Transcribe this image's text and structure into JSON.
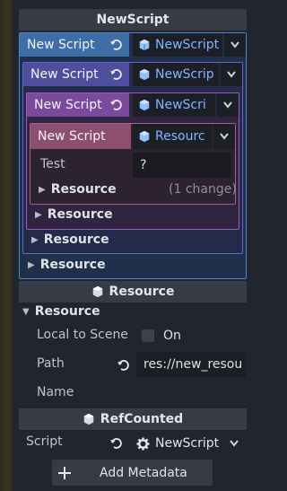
{
  "inspector": {
    "title": "NewScript",
    "nested": [
      {
        "label": "New Script",
        "picker_value": "NewScript"
      },
      {
        "label": "New Script",
        "picker_value": "NewScrip"
      },
      {
        "label": "New Script",
        "picker_value": "NewScri"
      },
      {
        "label": "New Script",
        "picker_value": "Resourc"
      }
    ],
    "test_property": {
      "label": "Test",
      "value": "?"
    },
    "sub_resources": [
      {
        "label": "Resource",
        "note": "(1 change)"
      },
      {
        "label": "Resource"
      },
      {
        "label": "Resource"
      },
      {
        "label": "Resource"
      }
    ],
    "resource_section": {
      "header": "Resource",
      "group": "Resource",
      "local_to_scene": {
        "label": "Local to Scene",
        "value": "On"
      },
      "path": {
        "label": "Path",
        "value": "res://new_resou"
      },
      "name": {
        "label": "Name",
        "value": ""
      }
    },
    "refcounted_section": {
      "header": "RefCounted",
      "script": {
        "label": "Script",
        "value": "NewScript"
      },
      "add_metadata": "Add Metadata"
    }
  },
  "colors": {
    "blue": "#3d6ea5",
    "indigo": "#4d4f9c",
    "purple": "#7c4a9d",
    "rose": "#8d4f6f",
    "accent": "#80b6ff"
  }
}
